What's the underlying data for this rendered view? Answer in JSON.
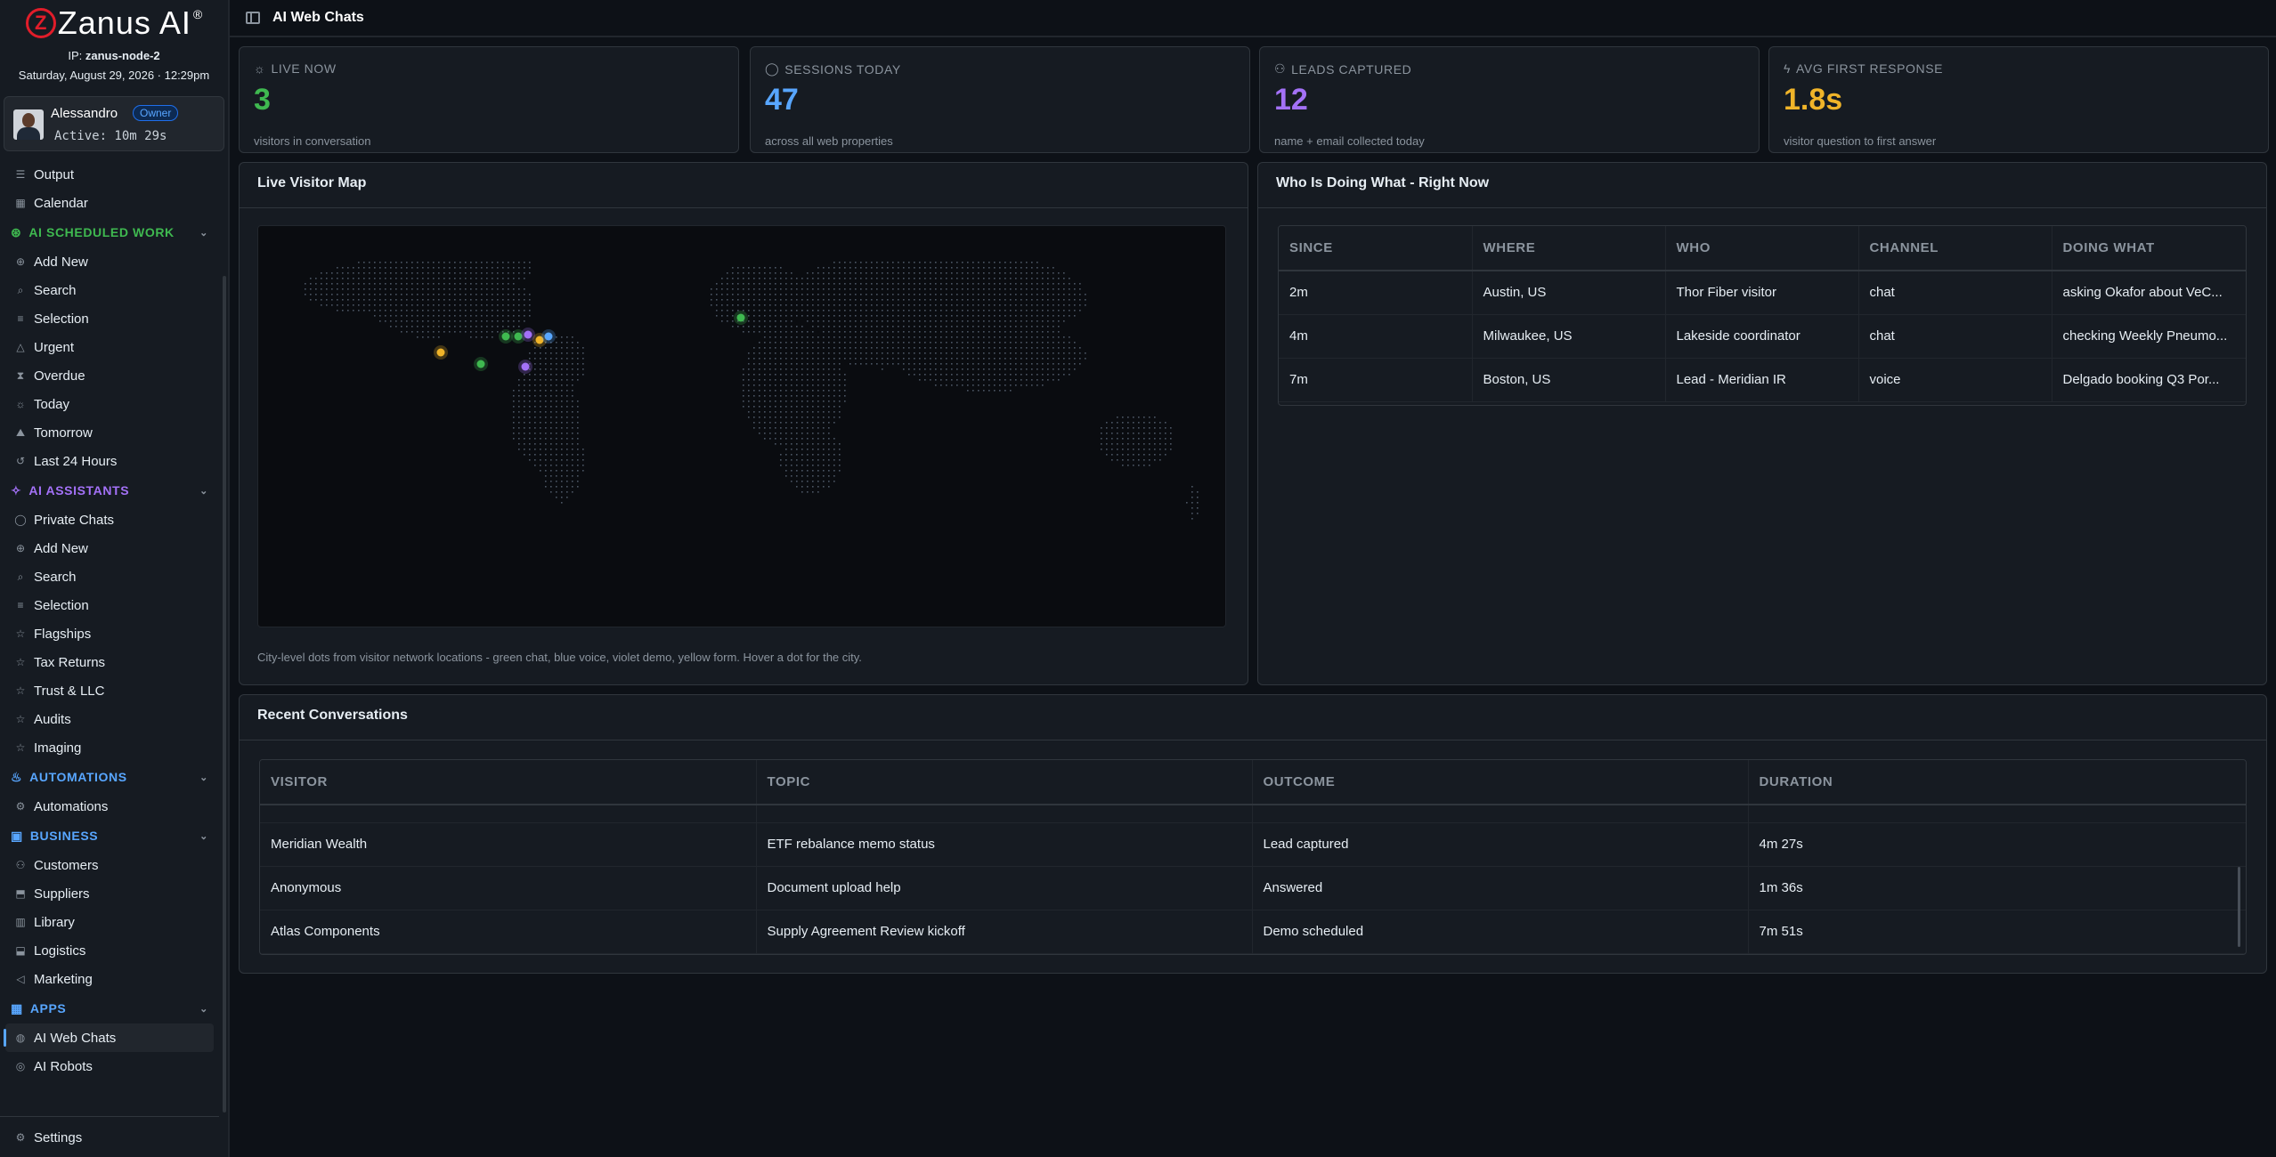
{
  "app": {
    "logo_letter": "Z",
    "logo_text": "Zanus AI",
    "logo_reg": "®",
    "ip_label": "IP:",
    "ip_value": "zanus-node-2",
    "datetime": "Saturday, August 29, 2026 · 12:29pm"
  },
  "user": {
    "name": "Alessandro",
    "role": "Owner",
    "active": "Active: 10m 29s"
  },
  "sidebar": {
    "top_items": [
      {
        "label": "Output",
        "icon": "output-icon"
      },
      {
        "label": "Calendar",
        "icon": "calendar-icon"
      }
    ],
    "sections": [
      {
        "title": "AI SCHEDULED WORK",
        "icon": "ai-scheduled-icon",
        "color": "#3fb950",
        "items": [
          "Add New",
          "Search",
          "Selection",
          "Urgent",
          "Overdue",
          "Today",
          "Tomorrow",
          "Last 24 Hours"
        ]
      },
      {
        "title": "AI ASSISTANTS",
        "icon": "sparkle-icon",
        "color": "#a371f7",
        "items": [
          "Private Chats",
          "Add New",
          "Search",
          "Selection",
          "Flagships",
          "Tax Returns",
          "Trust & LLC",
          "Audits",
          "Imaging"
        ]
      },
      {
        "title": "AUTOMATIONS",
        "icon": "automations-icon",
        "color": "#58a6ff",
        "items": [
          "Automations"
        ]
      },
      {
        "title": "BUSINESS",
        "icon": "briefcase-icon",
        "color": "#58a6ff",
        "items": [
          "Customers",
          "Suppliers",
          "Library",
          "Logistics",
          "Marketing"
        ]
      },
      {
        "title": "APPS",
        "icon": "apps-icon",
        "color": "#58a6ff",
        "items": [
          "AI Web Chats",
          "AI Robots"
        ]
      }
    ],
    "settings_label": "Settings"
  },
  "header": {
    "title": "AI Web Chats"
  },
  "stats": [
    {
      "label": "LIVE NOW",
      "icon": "live-icon",
      "value": "3",
      "sub": "visitors in conversation",
      "color": "#3fb950"
    },
    {
      "label": "SESSIONS TODAY",
      "icon": "chat-bubble-icon",
      "value": "47",
      "sub": "across all web properties",
      "color": "#58a6ff"
    },
    {
      "label": "LEADS CAPTURED",
      "icon": "user-plus-icon",
      "value": "12",
      "sub": "name + email collected today",
      "color": "#a371f7"
    },
    {
      "label": "AVG FIRST RESPONSE",
      "icon": "bolt-icon",
      "value": "1.8s",
      "sub": "visitor question to first answer",
      "color": "#f0b429"
    }
  ],
  "map_panel": {
    "title": "Live Visitor Map",
    "caption": "City-level dots from visitor network locations - green chat, blue voice, violet demo, yellow form. Hover a dot for the city.",
    "colors": {
      "chat": "#3fb950",
      "voice": "#58a6ff",
      "demo": "#a371f7",
      "form": "#f0b429"
    }
  },
  "activity_panel": {
    "title": "Who Is Doing What - Right Now",
    "columns": [
      "SINCE",
      "WHERE",
      "WHO",
      "CHANNEL",
      "DOING WHAT"
    ],
    "rows": [
      [
        "2m",
        "Austin, US",
        "Thor Fiber visitor",
        "chat",
        "asking Okafor about VeC..."
      ],
      [
        "4m",
        "Milwaukee, US",
        "Lakeside coordinator",
        "chat",
        "checking Weekly Pneumo..."
      ],
      [
        "7m",
        "Boston, US",
        "Lead - Meridian IR",
        "voice",
        "Delgado booking Q3 Por..."
      ]
    ]
  },
  "recent_panel": {
    "title": "Recent Conversations",
    "columns": [
      "VISITOR",
      "TOPIC",
      "OUTCOME",
      "DURATION"
    ],
    "rows": [
      [
        "Meridian Wealth",
        "ETF rebalance memo status",
        "Lead captured",
        "4m 27s"
      ],
      [
        "Anonymous",
        "Document upload help",
        "Answered",
        "1m 36s"
      ],
      [
        "Atlas Components",
        "Supply Agreement Review kickoff",
        "Demo scheduled",
        "7m 51s"
      ]
    ]
  }
}
